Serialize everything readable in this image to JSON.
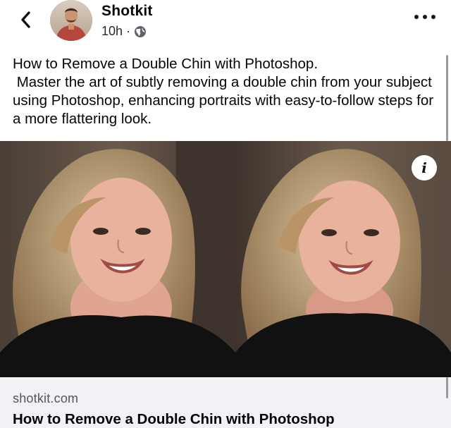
{
  "post": {
    "page_name": "Shotkit",
    "time": "10h",
    "separator": "·",
    "audience_icon": "globe-icon",
    "caption_line1": "How to Remove a Double Chin with Photoshop.",
    "caption_line2": " Master the art of subtly removing a double chin from your subject using Photoshop, enhancing portraits with easy-to-follow steps for a more flattering look."
  },
  "header": {
    "back_icon": "chevron-left-icon",
    "more_icon": "more-horizontal-icon"
  },
  "link_preview": {
    "info_label": "i",
    "domain": "shotkit.com",
    "title": "How to Remove a Double Chin with Photoshop"
  }
}
